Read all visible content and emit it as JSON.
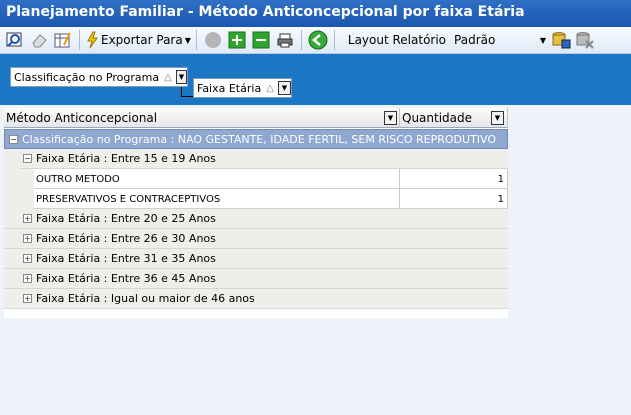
{
  "window": {
    "title": "Planejamento Familiar - Método Anticoncepcional por faixa Etária"
  },
  "toolbar": {
    "export_label": "Exportar Para",
    "layout_label": "Layout Relatório",
    "layout_value": "Padrão",
    "icons": [
      "preview-icon",
      "eraser-icon",
      "grid-edit-icon",
      "export-icon",
      "disabled-icon",
      "expand-all-icon",
      "collapse-all-icon",
      "print-icon",
      "back-icon",
      "save-layout-icon",
      "delete-layout-icon"
    ]
  },
  "group_panel": {
    "chips": [
      {
        "label": "Classificação no Programa",
        "sort": "△"
      },
      {
        "label": "Faixa Etária",
        "sort": "△"
      }
    ]
  },
  "grid": {
    "columns": [
      {
        "label": "Método Anticoncepcional"
      },
      {
        "label": "Quantidade"
      }
    ],
    "group1": "Classificação no Programa : NAO GESTANTE, IDADE FERTIL, SEM RISCO REPRODUTIVO",
    "expanded_group": "Faixa Etária : Entre 15 e 19 Anos",
    "rows": [
      {
        "metodo": "OUTRO METODO",
        "quantidade": "1"
      },
      {
        "metodo": "PRESERVATIVOS E CONTRACEPTIVOS",
        "quantidade": "1"
      }
    ],
    "collapsed_groups": [
      "Faixa Etária : Entre 20 e 25 Anos",
      "Faixa Etária : Entre 26 e 30 Anos",
      "Faixa Etária : Entre 31 e 35 Anos",
      "Faixa Etária : Entre 36 e 45 Anos",
      "Faixa Etária : Igual ou maior de 46 anos"
    ]
  }
}
